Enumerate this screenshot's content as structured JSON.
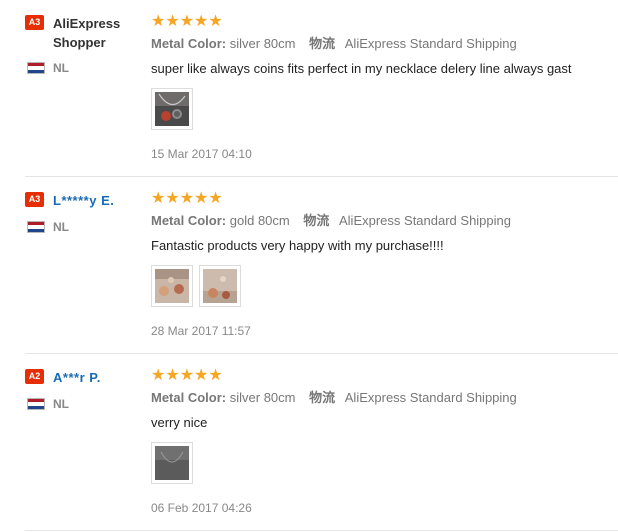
{
  "reviews": [
    {
      "level": "A3",
      "user_name": "AliExpress Shopper",
      "country": "NL",
      "stars": "★★★★★",
      "attr_label": "Metal Color:",
      "attr_value": "silver 80cm",
      "ship_label": "物流",
      "ship_value": "AliExpress Standard Shipping",
      "text": "super like always coins fits perfect in my necklace delery line always gast",
      "date": "15 Mar 2017 04:10",
      "photo_count": 1
    },
    {
      "level": "A3",
      "user_name": "L*****y E.",
      "country": "NL",
      "stars": "★★★★★",
      "attr_label": "Metal Color:",
      "attr_value": "gold 80cm",
      "ship_label": "物流",
      "ship_value": "AliExpress Standard Shipping",
      "text": "Fantastic products very happy with my purchase!!!!",
      "date": "28 Mar 2017 11:57",
      "photo_count": 2
    },
    {
      "level": "A2",
      "user_name": "A***r P.",
      "country": "NL",
      "stars": "★★★★★",
      "attr_label": "Metal Color:",
      "attr_value": "silver 80cm",
      "ship_label": "物流",
      "ship_value": "AliExpress Standard Shipping",
      "text": "verry nice",
      "date": "06 Feb 2017 04:26",
      "photo_count": 1
    }
  ],
  "colors": {
    "badge": "#e62e04",
    "star": "#f5a623",
    "anon_name": "#1a6bb5",
    "flag_red": "#ae1c28",
    "flag_white": "#ffffff",
    "flag_blue": "#21468b"
  }
}
